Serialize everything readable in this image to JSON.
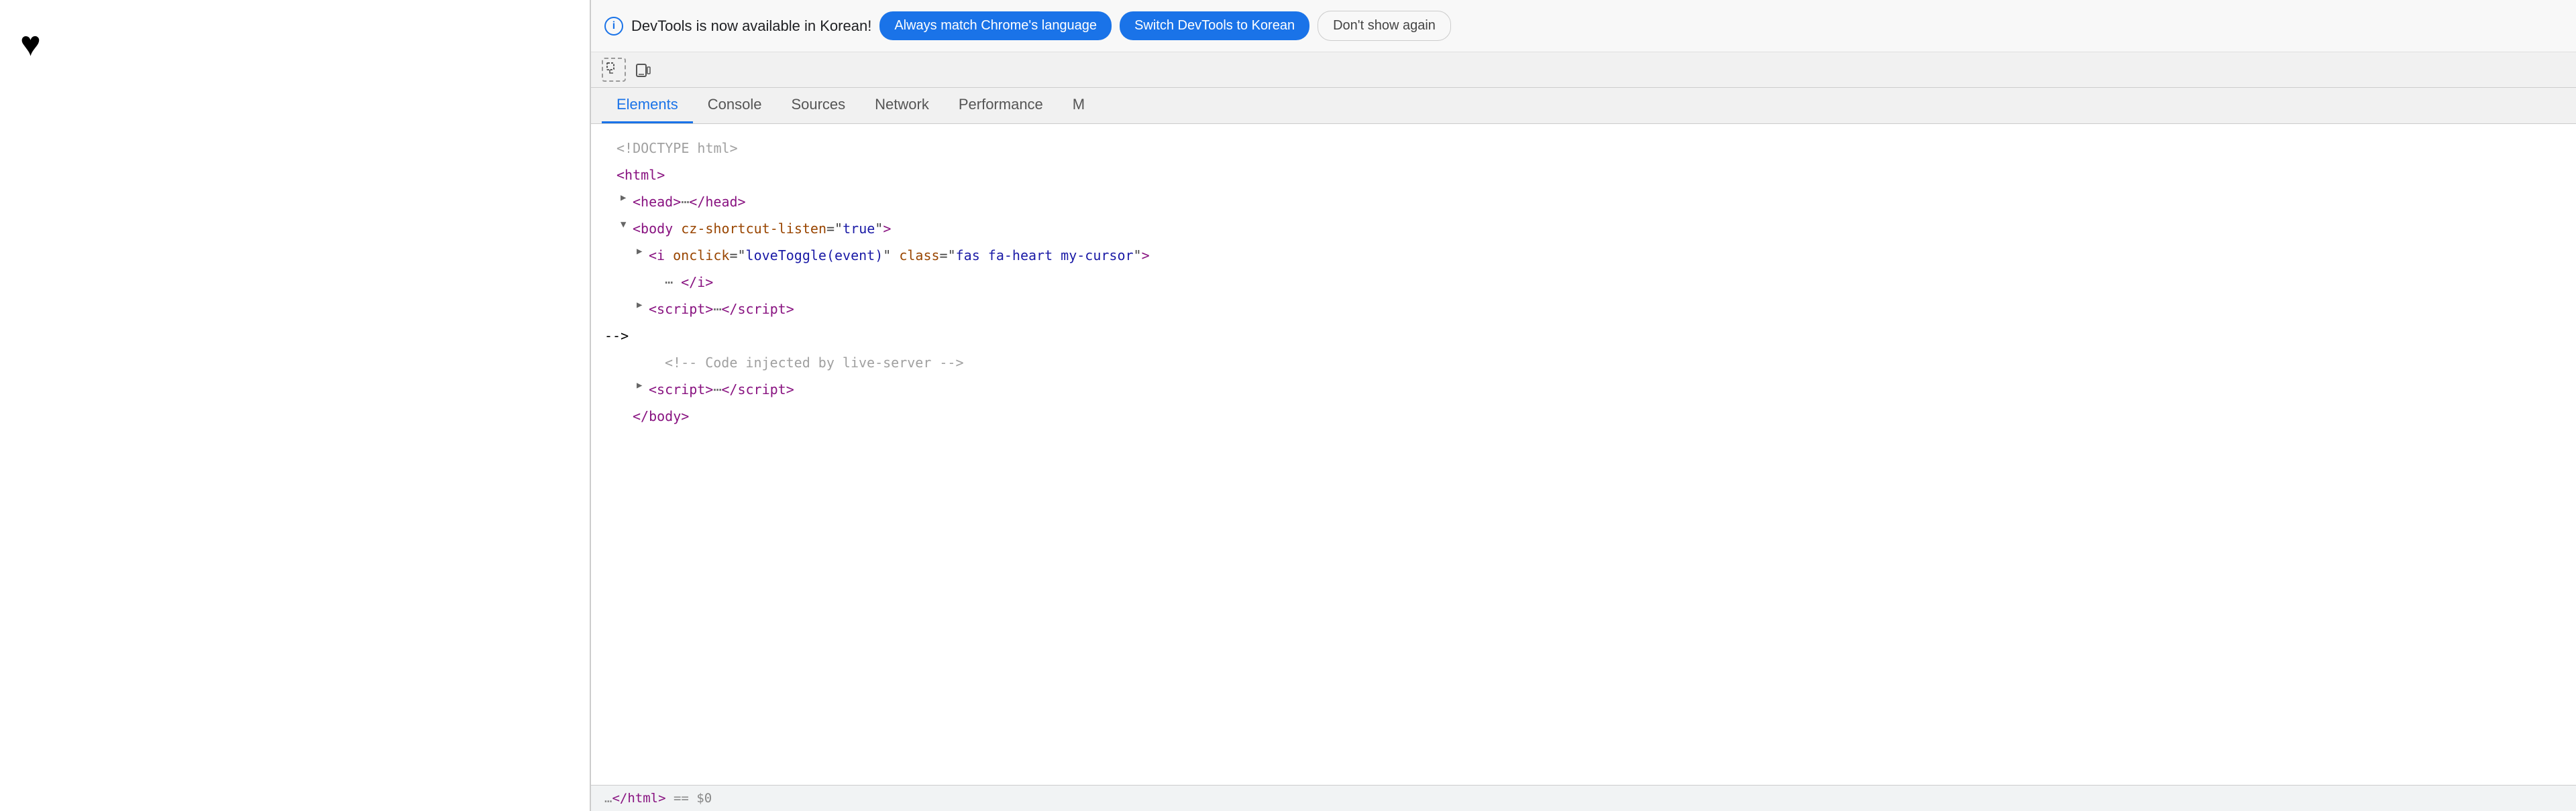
{
  "page": {
    "heart": "♥"
  },
  "notification": {
    "info_icon": "i",
    "message": "DevTools is now available in Korean!",
    "btn_always": "Always match Chrome's language",
    "btn_switch": "Switch DevTools to Korean",
    "btn_no_show": "Don't show again"
  },
  "toolbar": {
    "inspect_icon": "⬚",
    "device_icon": "⬚"
  },
  "tabs": [
    {
      "id": "elements",
      "label": "Elements",
      "active": true
    },
    {
      "id": "console",
      "label": "Console",
      "active": false
    },
    {
      "id": "sources",
      "label": "Sources",
      "active": false
    },
    {
      "id": "network",
      "label": "Network",
      "active": false
    },
    {
      "id": "performance",
      "label": "Performance",
      "active": false
    },
    {
      "id": "more",
      "label": "M",
      "active": false
    }
  ],
  "dom": {
    "lines": [
      {
        "indent": 0,
        "triangle": "none",
        "html": "doctype"
      },
      {
        "indent": 0,
        "triangle": "none",
        "html": "html_open"
      },
      {
        "indent": 1,
        "triangle": "closed",
        "html": "head"
      },
      {
        "indent": 1,
        "triangle": "open",
        "html": "body"
      },
      {
        "indent": 2,
        "triangle": "closed",
        "html": "i_tag"
      },
      {
        "indent": 3,
        "triangle": "none",
        "html": "ellipsis_i"
      },
      {
        "indent": 2,
        "triangle": "closed",
        "html": "script1"
      },
      {
        "indent": 2,
        "triangle": "none",
        "html": "comment"
      },
      {
        "indent": 2,
        "triangle": "closed",
        "html": "script2"
      },
      {
        "indent": 1,
        "triangle": "none",
        "html": "body_close"
      }
    ]
  },
  "status_bar": {
    "text": "…</html> == $0"
  }
}
